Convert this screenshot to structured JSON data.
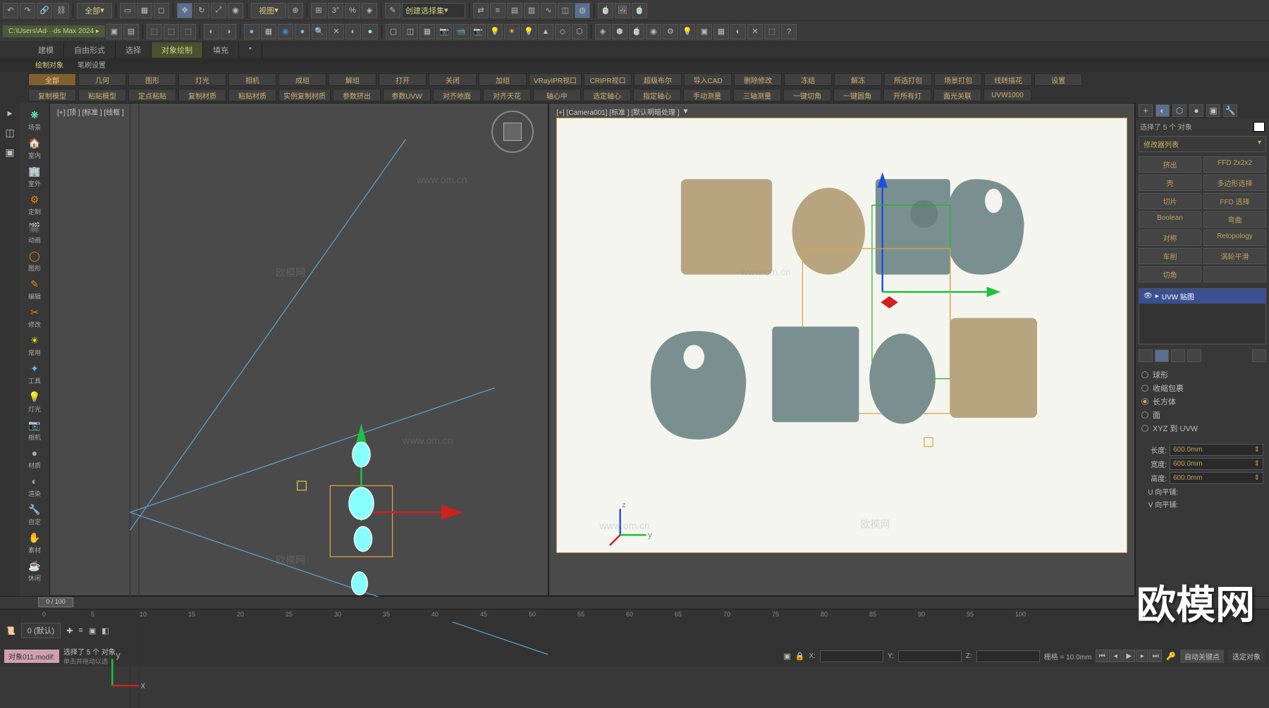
{
  "path": "C:\\Users\\Ad···ds Max 2024 ▸",
  "dropdowns": {
    "all": "全部",
    "view": "视图",
    "create_selection": "创建选择集"
  },
  "tabs": [
    "建模",
    "自由形式",
    "选择",
    "对象绘制",
    "填充"
  ],
  "active_tab": "对象绘制",
  "sub_tabs": [
    "绘制对象",
    "笔刷设置"
  ],
  "button_row1": [
    "全部",
    "几何",
    "图形",
    "灯光",
    "相机",
    "成组",
    "解组",
    "打开",
    "关闭",
    "加组",
    "VRayIPR视口",
    "CRIPR视口",
    "超级布尔",
    "导入CAD",
    "删除修改",
    "冻结",
    "解冻",
    "所选打包",
    "场景打包",
    "线转描花",
    "设置"
  ],
  "button_row2": [
    "复制模型",
    "粘贴模型",
    "定点粘贴",
    "复制材质",
    "粘贴材质",
    "实例复制材质",
    "参数挤出",
    "参数UVW",
    "对齐地面",
    "对齐天花",
    "轴心中",
    "选定轴心",
    "指定轴心",
    "手动测量",
    "三轴测量",
    "一键切角",
    "一键圆角",
    "开所有灯",
    "面光关联",
    "UVW1000"
  ],
  "categories": [
    {
      "icon": "❋",
      "label": "场景",
      "color": "#6fc"
    },
    {
      "icon": "🏠",
      "label": "室内",
      "color": "#e80"
    },
    {
      "icon": "🏢",
      "label": "室外",
      "color": "#e80"
    },
    {
      "icon": "⚙",
      "label": "定制",
      "color": "#e80"
    },
    {
      "icon": "🎬",
      "label": "动画",
      "color": "#e80"
    },
    {
      "icon": "◯",
      "label": "图形",
      "color": "#e80"
    },
    {
      "icon": "✎",
      "label": "编辑",
      "color": "#e80"
    },
    {
      "icon": "✂",
      "label": "修改",
      "color": "#e80"
    },
    {
      "icon": "☀",
      "label": "常用",
      "color": "#ee0"
    },
    {
      "icon": "✦",
      "label": "工具",
      "color": "#6bf"
    },
    {
      "icon": "💡",
      "label": "灯光",
      "color": "#aaa"
    },
    {
      "icon": "📷",
      "label": "相机",
      "color": "#aaa"
    },
    {
      "icon": "●",
      "label": "材质",
      "color": "#aaa"
    },
    {
      "icon": "◐",
      "label": "渲染",
      "color": "#aaa"
    },
    {
      "icon": "🔧",
      "label": "自定",
      "color": "#aaa"
    },
    {
      "icon": "✋",
      "label": "素材",
      "color": "#6c6"
    },
    {
      "icon": "☕",
      "label": "休闲",
      "color": "#aaa"
    }
  ],
  "viewport_left_label": "[+] [顶 ] [标准 ] [线框 ]",
  "viewport_right_label": "[+]  [Camera001]  [标准 ]  [默认明暗处理 ]",
  "selection_text": "选择了 5 个 对象",
  "modifier_list_label": "修改器列表",
  "mod_buttons_left": [
    "挤出",
    "壳",
    "切片",
    "Boolean",
    "对称",
    "车削",
    "切角"
  ],
  "mod_buttons_right": [
    "FFD 2x2x2",
    "多边形选择",
    "FFD 选择",
    "弯曲",
    "Retopology",
    "涡轮平滑",
    ""
  ],
  "mod_stack_item": "UVW 贴图",
  "gizmo_options": [
    "球形",
    "收缩包裹",
    "长方体",
    "面",
    "XYZ 到 UVW"
  ],
  "gizmo_checked": "长方体",
  "dimensions": {
    "length_label": "长度:",
    "length_val": "600.0mm",
    "width_label": "宽度:",
    "width_val": "600.0mm",
    "height_label": "高度:",
    "height_val": "600.0mm"
  },
  "tiling": {
    "u": "U 向平铺:",
    "v": "V 向平铺:"
  },
  "timeline": {
    "frame_display": "0 / 100",
    "ticks": [
      0,
      5,
      10,
      15,
      20,
      25,
      30,
      35,
      40,
      45,
      50,
      55,
      60,
      65,
      70,
      75,
      80,
      85,
      90,
      95,
      100
    ],
    "layer": "0 (默认)"
  },
  "status": {
    "script_name": "对象011.modif:",
    "hint": "单击并拖动以选",
    "selection": "选择了 5 个 对象",
    "x": "X:",
    "y": "Y:",
    "z": "Z:",
    "grid": "栅格 = 10.0mm",
    "autokey": "自动关键点",
    "select_obj": "选定对象"
  },
  "watermarks": [
    "欧模网",
    "www.om.cn"
  ],
  "big_watermark": "欧模网"
}
